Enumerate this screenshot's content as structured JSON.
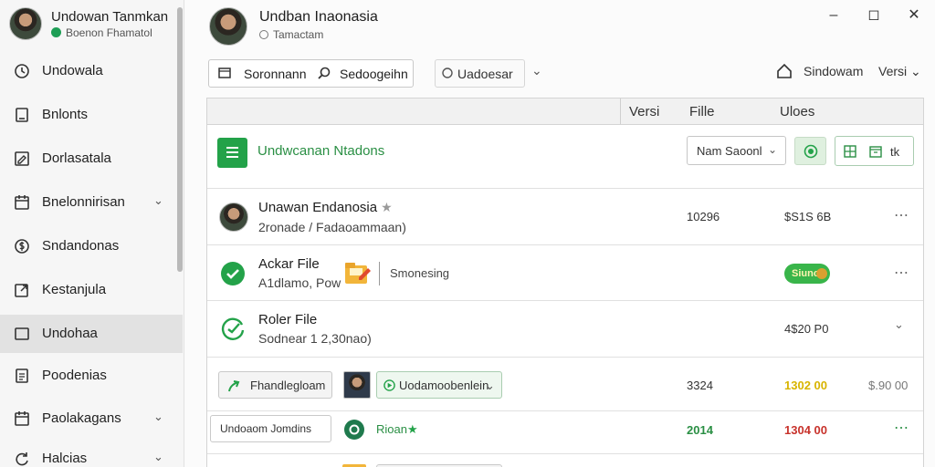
{
  "sidebar": {
    "profile_name": "Undowan Tanmkan",
    "profile_sub": "Boenon Fhamatol",
    "items": [
      {
        "label": "Undowala",
        "icon": "clock-icon",
        "chevron": false
      },
      {
        "label": "Bnlonts",
        "icon": "document-icon",
        "chevron": false
      },
      {
        "label": "Dorlasatala",
        "icon": "edit-icon",
        "chevron": false
      },
      {
        "label": "Bnelonnirisan",
        "icon": "calendar-icon",
        "chevron": true
      },
      {
        "label": "Sndandonas",
        "icon": "currency-icon",
        "chevron": false
      },
      {
        "label": "Kestanjula",
        "icon": "export-icon",
        "chevron": false
      },
      {
        "label": "Undohaa",
        "icon": "box-icon",
        "chevron": false,
        "active": true
      },
      {
        "label": "Poodenias",
        "icon": "list-icon",
        "chevron": false
      },
      {
        "label": "Paolakagans",
        "icon": "calendar-icon",
        "chevron": true
      },
      {
        "label": "Halcias",
        "icon": "refresh-icon",
        "chevron": true
      }
    ]
  },
  "header": {
    "title": "Undban Inaonasia",
    "subtitle": "Tamactam"
  },
  "toolbar": {
    "btn1_label": "Soronnann",
    "btn2_label": "Sedoogeihn",
    "select_label": "Uadoesar",
    "home_label": "Sindowam",
    "versi_label": "Versi"
  },
  "table": {
    "headers": [
      "Versi",
      "Fille",
      "Uloes"
    ],
    "section_title": "Undwcanan Ntadons",
    "section_select": "Nam Saoonl",
    "grid_label": "tk",
    "rows": [
      {
        "title": "Unawan Endanosia",
        "sub": "2ronade / Fadaoammaan)",
        "num1": "10296",
        "num2": "$S1S 6B"
      },
      {
        "title": "Ackar File",
        "sub": "A1dlamo, Pow",
        "status": "Smonesing",
        "badge": "Siuno",
        "num1": "",
        "num2": ""
      },
      {
        "title": "Roler File",
        "sub": "Sodnear 1 2,30nao)",
        "num1": "",
        "num2": "4$20 P0"
      },
      {
        "pill": "Fhandlegloam",
        "pill2": "Uodamoobenlein",
        "num1": "3324",
        "num2": "1302 00",
        "num3": "$.90 00"
      },
      {
        "pill": "Undoaom Jomdins",
        "label": "Rioan",
        "num1": "2014",
        "num2": "1304 00"
      }
    ]
  },
  "colors": {
    "accent": "#23a249",
    "danger": "#c8332c",
    "warning": "#d8b400"
  }
}
